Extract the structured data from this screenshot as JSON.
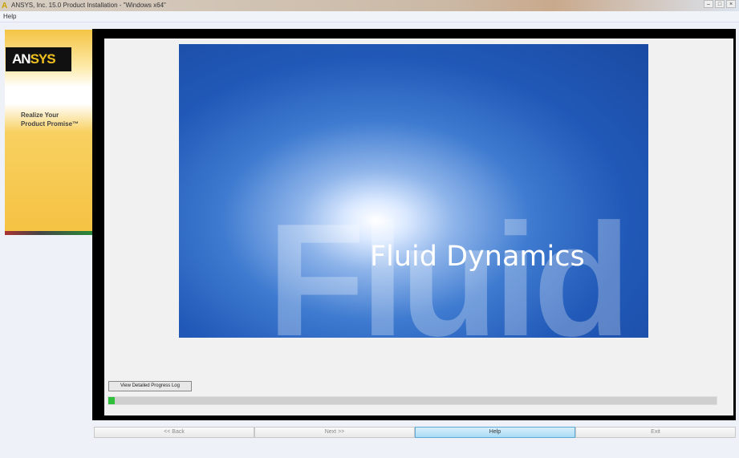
{
  "window": {
    "title": "ANSYS, Inc. 15.0 Product Installation - \"Windows x64\"",
    "logo_glyph": "A"
  },
  "menu": {
    "items": [
      "Help"
    ]
  },
  "sidebar": {
    "brand_left": "AN",
    "brand_right": "SYS",
    "tagline_line1": "Realize Your",
    "tagline_line2": "Product Promise™"
  },
  "hero": {
    "title": "Fluid Dynamics",
    "watermark": "Fluid"
  },
  "log_button": "View Detailed Progress Log",
  "progress": {
    "percent": 1,
    "color": "#2fbf3a"
  },
  "buttons": {
    "back": "<< Back",
    "next": "Next >>",
    "help": "Help",
    "exit": "Exit"
  }
}
